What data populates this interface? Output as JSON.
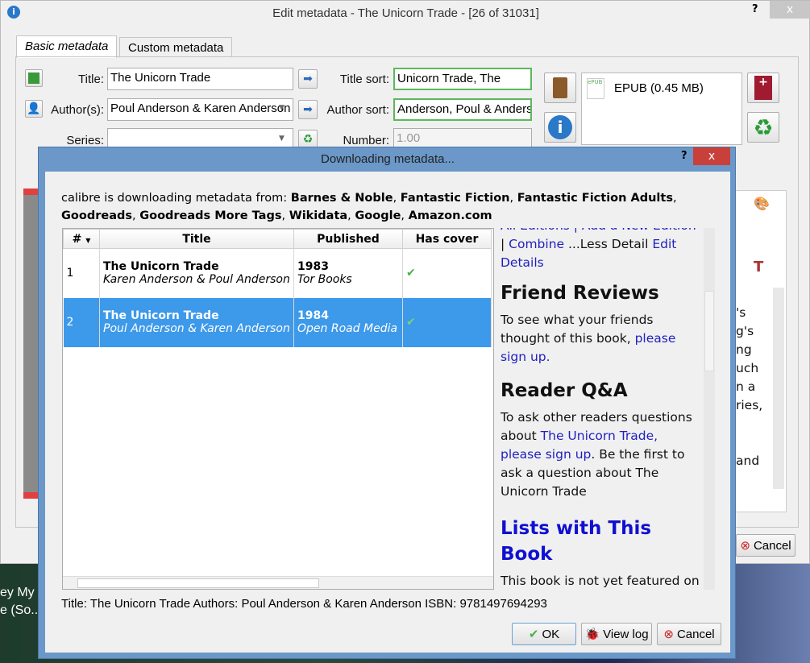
{
  "main": {
    "title": "Edit metadata - The Unicorn Trade -  [26 of 31031]",
    "help": "?",
    "close": "x",
    "tabs": [
      "Basic metadata",
      "Custom metadata"
    ],
    "title_label": "Title:",
    "title_value": "The Unicorn Trade",
    "authors_label": "Author(s):",
    "authors_value": "Poul Anderson & Karen Anderson",
    "series_label": "Series:",
    "series_value": "",
    "title_sort_label": "Title sort:",
    "title_sort_value": "Unicorn Trade, The",
    "author_sort_label": "Author sort:",
    "author_sort_value": "Anderson, Poul & Anderson",
    "number_label": "Number:",
    "number_value": "1.00",
    "format": "EPUB (0.45 MB)",
    "format_badge": "ePUB",
    "cancel": "Cancel",
    "bg_text": [
      "'s",
      "g's",
      "ng",
      "uch",
      "n a",
      "ries,",
      "and"
    ]
  },
  "desktop": {
    "icon_text": [
      "ey My",
      "e (So..."
    ]
  },
  "dialog": {
    "title": "Downloading metadata...",
    "help": "?",
    "close": "x",
    "intro_prefix": "calibre is downloading metadata from: ",
    "sources": [
      "Barnes & Noble",
      "Fantastic Fiction",
      "Fantastic Fiction Adults",
      "Goodreads",
      "Goodreads More Tags",
      "Wikidata",
      "Google",
      "Amazon.com"
    ],
    "columns": [
      "#",
      "Title",
      "Published",
      "Has cover"
    ],
    "rows": [
      {
        "num": "1",
        "title": "The Unicorn Trade",
        "authors": "Karen Anderson & Poul Anderson",
        "year": "1983",
        "publisher": "Tor Books",
        "has_cover": true,
        "selected": false
      },
      {
        "num": "2",
        "title": "The Unicorn Trade",
        "authors": "Poul Anderson & Karen Anderson",
        "year": "1984",
        "publisher": "Open Road Media",
        "has_cover": true,
        "selected": true
      }
    ],
    "web": {
      "top_links": "All Editions | Add a New Edition",
      "combine": "Combine",
      "less_detail": " ...Less Detail ",
      "edit_details": "Edit Details",
      "friend_heading": "Friend Reviews",
      "friend_text": "To see what your friends thought of this book, ",
      "friend_link": "please sign up.",
      "qa_heading": "Reader Q&A",
      "qa_text1": "To ask other readers questions about ",
      "qa_link1": "The Unicorn Trade,",
      "qa_link2": "please sign up",
      "qa_text2": ". Be the first to ask a question about The Unicorn Trade",
      "lists_heading": "Lists with This Book",
      "lists_text": "This book is not yet featured on"
    },
    "status": "Title: The Unicorn Trade Authors: Poul Anderson & Karen Anderson ISBN: 9781497694293",
    "ok": "OK",
    "view_log": "View log",
    "cancel": "Cancel"
  }
}
